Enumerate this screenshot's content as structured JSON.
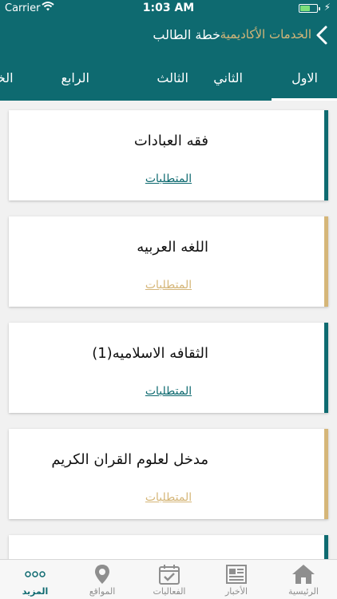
{
  "status_bar": {
    "carrier": "Carrier",
    "time": "1:03 AM"
  },
  "nav": {
    "back_label": "الخدمات الأكاديمية",
    "title": "خطة الطالب"
  },
  "tabs": [
    {
      "label": "الاول",
      "selected": true
    },
    {
      "label": "الثاني"
    },
    {
      "label": "الثالث"
    },
    {
      "label": "الرابع"
    },
    {
      "label": "الخا"
    }
  ],
  "courses": [
    {
      "name": "فقه العبادات",
      "requirements_label": "المتطلبات",
      "accent": "#0e6a70"
    },
    {
      "name": "اللغه العربيه",
      "requirements_label": "المتطلبات",
      "accent": "#d5b678"
    },
    {
      "name": "الثقافه الاسلاميه(1)",
      "requirements_label": "المتطلبات",
      "accent": "#0e6a70"
    },
    {
      "name": "مدخل لعلوم القران الكريم",
      "requirements_label": "المتطلبات",
      "accent": "#d5b678"
    },
    {
      "name": "",
      "requirements_label": "",
      "accent": "#0e6a70"
    }
  ],
  "tabbar": {
    "items": [
      {
        "label": "الرئيسية",
        "icon": "home-icon"
      },
      {
        "label": "الأخبار",
        "icon": "newspaper-icon"
      },
      {
        "label": "الفعاليات",
        "icon": "calendar-icon"
      },
      {
        "label": "المواقع",
        "icon": "location-pin-icon"
      },
      {
        "label": "المزيد",
        "icon": "more-icon",
        "selected": true
      }
    ]
  },
  "colors": {
    "primary": "#0e6a70",
    "gold": "#d5b678",
    "background": "#f1f1f1"
  }
}
